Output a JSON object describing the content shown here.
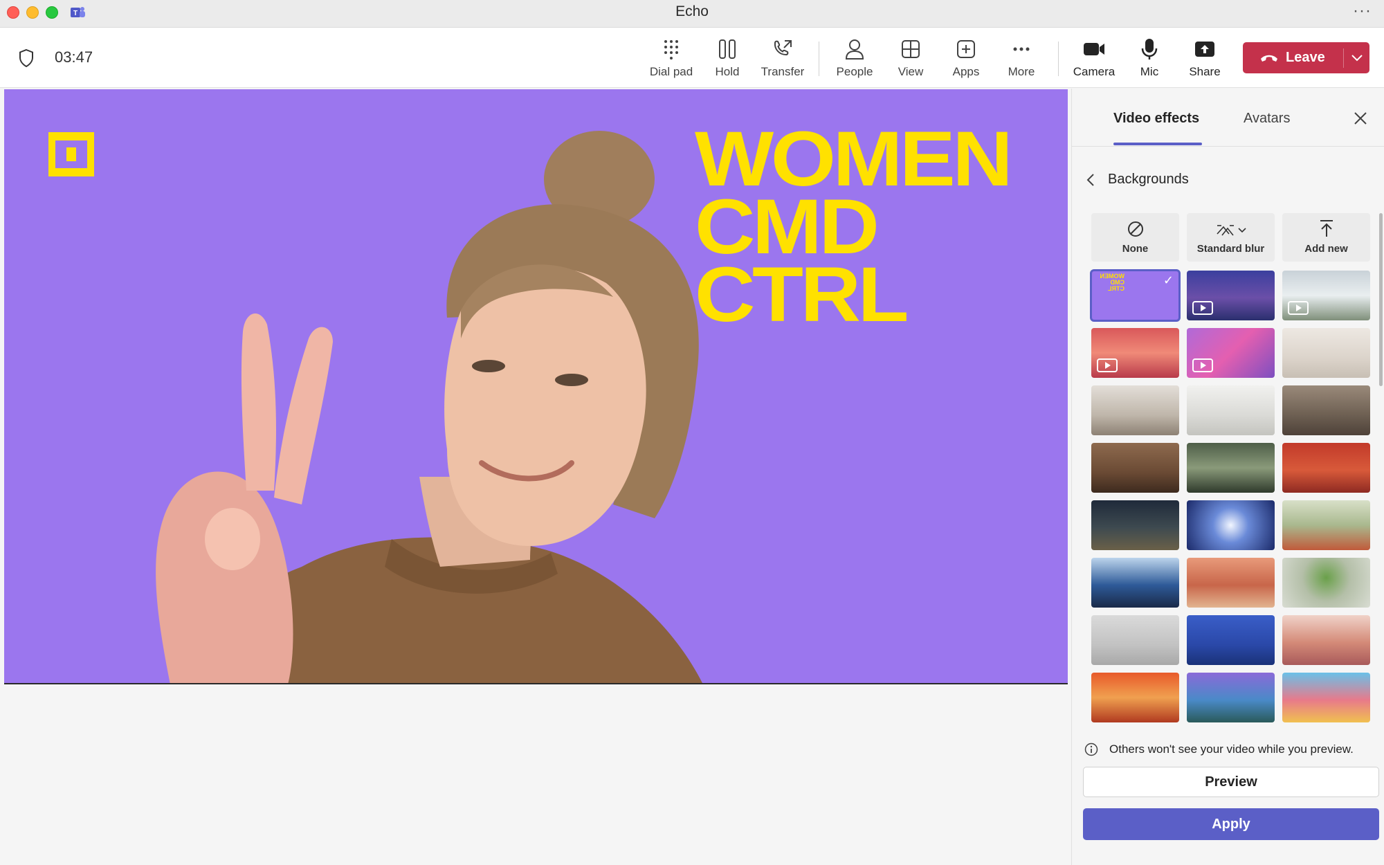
{
  "window": {
    "title": "Echo"
  },
  "call": {
    "timer": "03:47"
  },
  "toolbar": {
    "buttons": [
      {
        "id": "dialpad",
        "label": "Dial pad",
        "icon": "dialpad-icon"
      },
      {
        "id": "hold",
        "label": "Hold",
        "icon": "pause-icon"
      },
      {
        "id": "transfer",
        "label": "Transfer",
        "icon": "transfer-icon"
      },
      {
        "id": "people",
        "label": "People",
        "icon": "person-icon"
      },
      {
        "id": "view",
        "label": "View",
        "icon": "grid-icon"
      },
      {
        "id": "apps",
        "label": "Apps",
        "icon": "plus-square-icon"
      },
      {
        "id": "more",
        "label": "More",
        "icon": "ellipsis-icon"
      },
      {
        "id": "camera",
        "label": "Camera",
        "icon": "camera-icon"
      },
      {
        "id": "mic",
        "label": "Mic",
        "icon": "microphone-icon"
      },
      {
        "id": "share",
        "label": "Share",
        "icon": "share-icon"
      }
    ],
    "leave_label": "Leave",
    "leave_color": "#c4314b"
  },
  "video": {
    "background_color": "#9b76ee",
    "headline": [
      "WOMEN",
      "CMD",
      "CTRL"
    ],
    "headline_color": "#ffe100"
  },
  "panel": {
    "tabs": [
      {
        "label": "Video effects",
        "active": true
      },
      {
        "label": "Avatars",
        "active": false
      }
    ],
    "back_label": "Backgrounds",
    "options": [
      {
        "label": "None",
        "icon": "none-icon"
      },
      {
        "label": "Standard blur",
        "icon": "blur-icon"
      },
      {
        "label": "Add new",
        "icon": "upload-icon"
      }
    ],
    "info_text": "Others won't see your video while you preview.",
    "preview_label": "Preview",
    "apply_label": "Apply",
    "accent_color": "#5b5fc7",
    "thumbnail_count": 24,
    "selected_thumbnail": 0
  }
}
